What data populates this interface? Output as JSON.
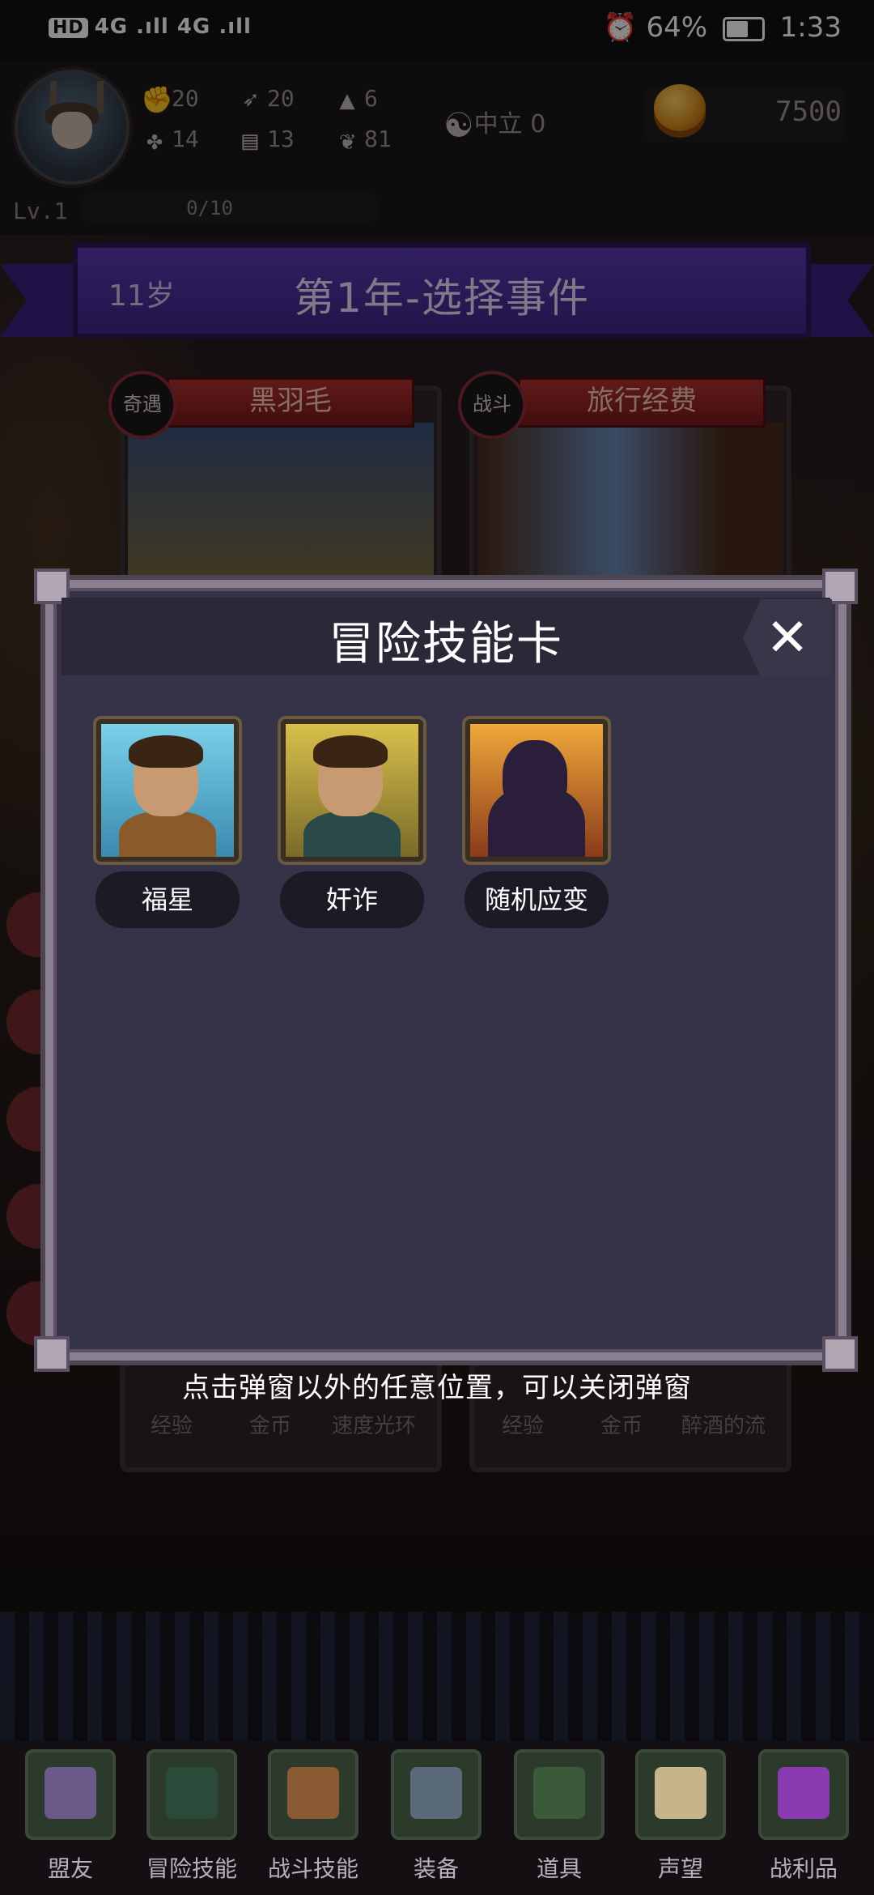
{
  "status_bar": {
    "network": "4G .ıll 4G .ıll",
    "hd": "HD",
    "alarm_icon": "alarm-icon",
    "battery": "64%",
    "time": "1:33"
  },
  "player": {
    "stats": [
      {
        "icon": "fist-icon",
        "value": "20"
      },
      {
        "icon": "feather-icon",
        "value": "20"
      },
      {
        "icon": "wizard-hat-icon",
        "value": "6"
      },
      {
        "icon": "clover-icon",
        "value": "14"
      },
      {
        "icon": "scroll-icon",
        "value": "13"
      },
      {
        "icon": "lotus-icon",
        "value": "81"
      }
    ],
    "alignment": "中立 0",
    "gold": "7500",
    "level": "Lv.1",
    "exp": "0/10"
  },
  "banner": {
    "age": "11岁",
    "title": "第1年-选择事件"
  },
  "event_cards": [
    {
      "tag": "奇遇",
      "title": "黑羽毛",
      "rewards": [
        "经验",
        "金币",
        "速度光环"
      ]
    },
    {
      "tag": "战斗",
      "title": "旅行经费",
      "rewards": [
        "经验",
        "金币",
        "醉酒的流"
      ]
    }
  ],
  "modal": {
    "title": "冒险技能卡",
    "close_symbol": "✕",
    "skills": [
      {
        "name": "福星"
      },
      {
        "name": "奸诈"
      },
      {
        "name": "随机应变"
      }
    ],
    "hint": "点击弹窗以外的任意位置，可以关闭弹窗"
  },
  "bottom_nav": [
    {
      "label": "盟友",
      "icon": "gloves-icon"
    },
    {
      "label": "冒险技能",
      "icon": "spellbook-icon"
    },
    {
      "label": "战斗技能",
      "icon": "backpack-icon"
    },
    {
      "label": "装备",
      "icon": "crossed-swords-icon"
    },
    {
      "label": "道具",
      "icon": "pouch-icon"
    },
    {
      "label": "声望",
      "icon": "scroll-icon"
    },
    {
      "label": "战利品",
      "icon": "treasure-chest-icon"
    }
  ],
  "colors": {
    "banner_purple": "#4a2c9c",
    "ribbon_red": "#a02828",
    "modal_bg": "#363248",
    "gold": "#e09a22"
  }
}
